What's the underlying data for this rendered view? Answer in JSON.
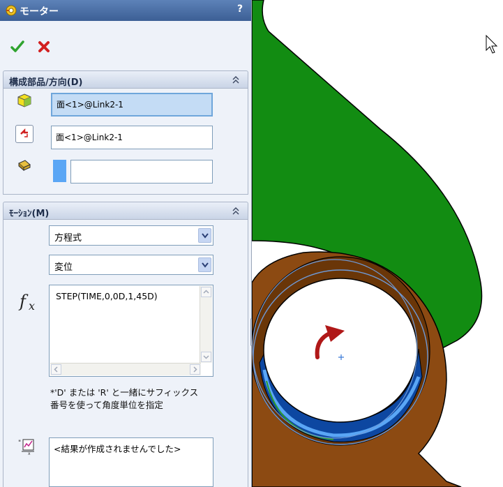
{
  "title": "モーター",
  "help_label": "?",
  "icons": {
    "title": "motor-icon",
    "ok": "checkmark-icon",
    "cancel": "x-icon",
    "components": "cube-icon",
    "direction": "direction-arrow-icon",
    "relative": "relative-move-icon",
    "function": "fx-icon",
    "graph": "graph-icon",
    "rotation": "rotation-arrow-icon"
  },
  "colors": {
    "accent": "#3c5f95",
    "ok": "#2fa32f",
    "cancel": "#d22020",
    "part_green": "#108a10",
    "part_brown": "#8a4a10",
    "face_blue": "#0d47a1"
  },
  "components_section": {
    "label": "構成部品/方向(D)",
    "component_value": "面<1>@Link2-1",
    "direction_value": "面<1>@Link2-1",
    "relative_value": ""
  },
  "motion_section": {
    "label": "ﾓｰｼｮﾝ(M)",
    "type_select": "方程式",
    "variable_select": "変位",
    "expression": "STEP(TIME,0,0D,1,45D)",
    "note_line1": "*'D' または 'R' と一緒にサフィックス",
    "note_line2": "番号を使って角度単位を指定",
    "result_text": "<結果が作成されませんでした>"
  }
}
